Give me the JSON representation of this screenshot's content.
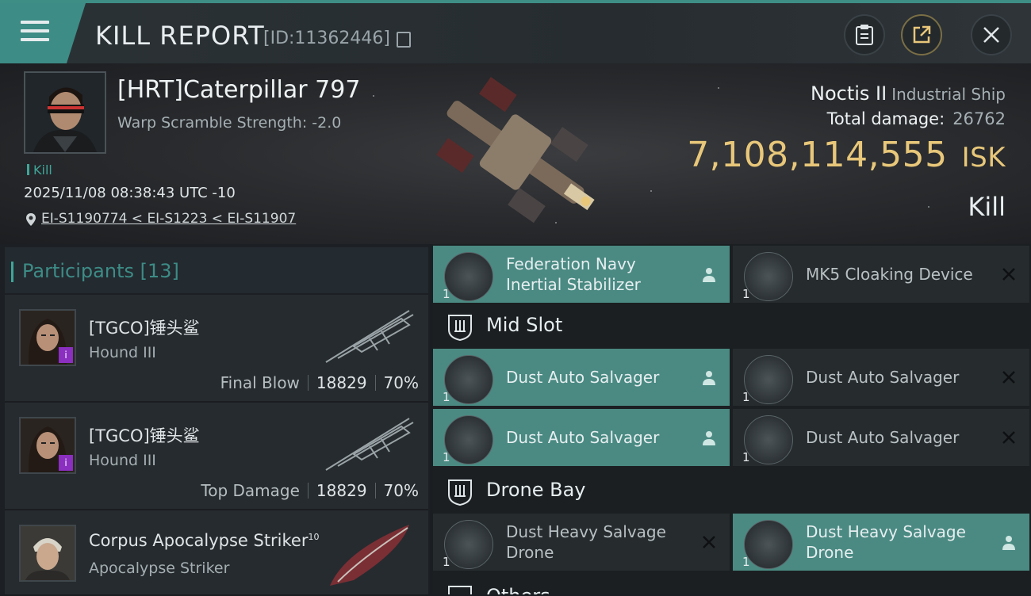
{
  "header": {
    "title": "KILL REPORT",
    "report_id": "[ID:11362446]"
  },
  "victim": {
    "name": "[HRT]Caterpillar 797",
    "warp_scramble": "Warp Scramble Strength: -2.0",
    "tag": "Kill",
    "date": "2025/11/08 08:38:43 UTC -10",
    "location": "EI-S1190774 < EI-S1223 < EI-S11907",
    "ship_name": "Noctis II",
    "ship_class": "Industrial Ship",
    "total_damage_label": "Total damage:",
    "total_damage": "26762",
    "isk_value": "7,108,114,555",
    "isk_unit": "ISK",
    "result": "Kill"
  },
  "participants": {
    "title": "Participants",
    "count": "[13]",
    "list": [
      {
        "name": "[TGCO]锤头鲨",
        "ship": "Hound III",
        "role": "Final Blow",
        "damage": "18829",
        "percent": "70%",
        "badge": "i"
      },
      {
        "name": "[TGCO]锤头鲨",
        "ship": "Hound III",
        "role": "Top Damage",
        "damage": "18829",
        "percent": "70%",
        "badge": "i"
      },
      {
        "name": "Corpus Apocalypse Striker",
        "level": "10",
        "ship": "Apocalypse Striker"
      }
    ]
  },
  "modules": {
    "low": [
      {
        "name_line1": "Federation Navy",
        "name_line2": "Inertial Stabilizer",
        "qty": "1",
        "state": "active",
        "action": "person-icon"
      },
      {
        "name_line1": "MK5 Cloaking Device",
        "name_line2": "",
        "qty": "1",
        "state": "inactive",
        "action": "close-icon"
      }
    ],
    "mid_title": "Mid Slot",
    "mid": [
      {
        "name_line1": "Dust Auto Salvager",
        "qty": "1",
        "state": "active",
        "action": "person-icon"
      },
      {
        "name_line1": "Dust Auto Salvager",
        "qty": "1",
        "state": "inactive",
        "action": "close-icon"
      },
      {
        "name_line1": "Dust Auto Salvager",
        "qty": "1",
        "state": "active",
        "action": "person-icon"
      },
      {
        "name_line1": "Dust Auto Salvager",
        "qty": "1",
        "state": "inactive",
        "action": "close-icon"
      }
    ],
    "drone_title": "Drone Bay",
    "drones": [
      {
        "name_line1": "Dust Heavy Salvage",
        "name_line2": "Drone",
        "qty": "1",
        "state": "inactive",
        "action": "close-icon"
      },
      {
        "name_line1": "Dust Heavy Salvage",
        "name_line2": "Drone",
        "qty": "1",
        "state": "active",
        "action": "person-icon"
      }
    ],
    "others_title": "Others"
  },
  "colors": {
    "accent": "#3fa597",
    "isk": "#e8c77a",
    "active_module": "#4a8a82"
  }
}
